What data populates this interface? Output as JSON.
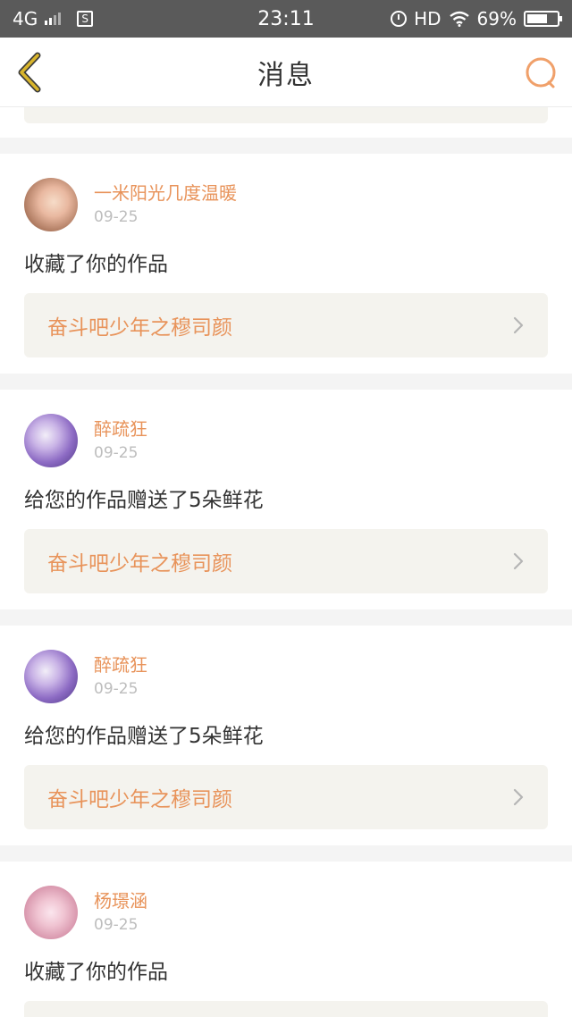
{
  "status_bar": {
    "network": "4G",
    "sim_badge": "S",
    "time": "23:11",
    "hd": "HD",
    "battery_percent": "69%",
    "battery_level": 0.69
  },
  "header": {
    "title": "消息",
    "back_icon": "chevron-left-icon",
    "search_icon": "search-icon"
  },
  "colors": {
    "accent": "#e8935a",
    "back_arrow": "#d9b52c",
    "ref_bg": "#f4f3ee"
  },
  "messages": [
    {
      "username": "一米阳光几度温暖",
      "date": "09-25",
      "action": "收藏了你的作品",
      "work_title": "奋斗吧少年之穆司颜"
    },
    {
      "username": "醉疏狂",
      "date": "09-25",
      "action": "给您的作品赠送了5朵鲜花",
      "work_title": "奋斗吧少年之穆司颜"
    },
    {
      "username": "醉疏狂",
      "date": "09-25",
      "action": "给您的作品赠送了5朵鲜花",
      "work_title": "奋斗吧少年之穆司颜"
    },
    {
      "username": "杨璟涵",
      "date": "09-25",
      "action": "收藏了你的作品",
      "work_title": ""
    }
  ]
}
